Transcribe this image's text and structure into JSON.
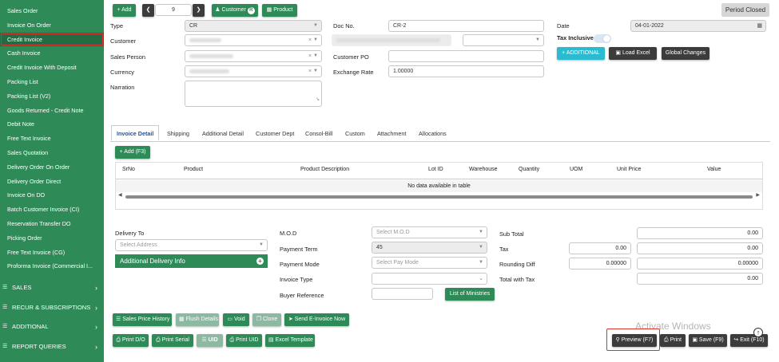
{
  "sidebar": {
    "items": [
      "Sales Order",
      "Invoice On Order",
      "Credit Invoice",
      "Cash Invoice",
      "Credit Invoice With Deposit",
      "Packing List",
      "Packing List (V2)",
      "Goods Returned - Credit Note",
      "Debit Note",
      "Free Text Invoice",
      "Sales Quotation",
      "Delivery Order On Order",
      "Delivery Order Direct",
      "Invoice On DO",
      "Batch Customer Invoice (CI)",
      "Reservation Transfer DO",
      "Picking Order",
      "Free Text Invoice (CG)",
      "Proforma Invoice (Commercial I..."
    ],
    "sections": [
      "SALES",
      "RECUR & SUBSCRIPTIONS",
      "ADDITIONAL",
      "REPORT QUERIES"
    ]
  },
  "toolbar": {
    "add": "Add",
    "page_value": "9",
    "customer": "Customer",
    "customer_badge": "R",
    "product": "Product",
    "period_closed": "Period Closed"
  },
  "form": {
    "type_label": "Type",
    "type_value": "CR",
    "customer_label": "Customer",
    "sales_person_label": "Sales Person",
    "currency_label": "Currency",
    "narration_label": "Narration",
    "doc_no_label": "Doc No.",
    "doc_no_value": "CR-2",
    "customer_po_label": "Customer PO",
    "exchange_rate_label": "Exchange Rate",
    "exchange_rate_value": "1.00000",
    "date_label": "Date",
    "date_value": "04-01-2022",
    "tax_inclusive_label": "Tax Inclusive",
    "additional": "ADDITIONAL",
    "load_excel": "Load Excel",
    "global_changes": "Global Changes"
  },
  "tabs": [
    "Invoice Detail",
    "Shipping",
    "Additional Detail",
    "Customer Dept",
    "Consol-Bill",
    "Custom",
    "Attachment",
    "Allocations"
  ],
  "grid": {
    "add": "Add (F3)",
    "columns": [
      "SrNo",
      "Product",
      "Product Description",
      "Lot ID",
      "Warehouse",
      "Quantity",
      "UOM",
      "Unit Price",
      "Value"
    ],
    "empty": "No data available in table"
  },
  "delivery": {
    "label": "Delivery To",
    "placeholder": "Select Address",
    "additional_info": "Additional Delivery Info"
  },
  "mod": {
    "mod_label": "M.O.D",
    "mod_placeholder": "Select M.O.D",
    "payment_term_label": "Payment Term",
    "payment_term_value": "45",
    "payment_mode_label": "Payment Mode",
    "payment_mode_placeholder": "Select Pay Mode",
    "invoice_type_label": "Invoice Type",
    "buyer_reference_label": "Buyer Reference",
    "list_of_ministries": "List of Ministries"
  },
  "totals": {
    "sub_total_label": "Sub Total",
    "sub_total": "0.00",
    "tax_label": "Tax",
    "tax_a": "0.00",
    "tax_b": "0.00",
    "rounding_label": "Rounding Diff",
    "rounding_a": "0.00000",
    "rounding_b": "0.00000",
    "total_with_tax_label": "Total with Tax",
    "total_with_tax": "0.00"
  },
  "actions_row1": [
    "Sales Price History",
    "Flush Details",
    "Void",
    "Clone",
    "Send E-Invoice Now"
  ],
  "actions_row2": [
    "Print D/O",
    "Print Serial",
    "UID",
    "Print UID",
    "Excel Template"
  ],
  "footer": {
    "preview": "Preview (F7)",
    "print": "Print",
    "save": "Save (F9)",
    "exit": "Exit (F10)",
    "watermark": "Activate Windows"
  }
}
